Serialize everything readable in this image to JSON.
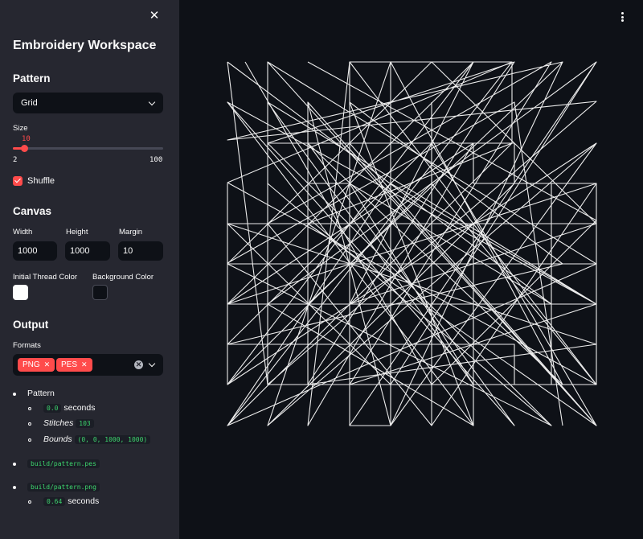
{
  "sidebar": {
    "title": "Embroidery Workspace",
    "pattern_section": {
      "heading": "Pattern",
      "select_value": "Grid",
      "size_label": "Size",
      "size_value": "10",
      "size_fraction": 0.0816,
      "size_min": "2",
      "size_max": "100",
      "shuffle_label": "Shuffle",
      "shuffle_checked": true
    },
    "canvas_section": {
      "heading": "Canvas",
      "width_label": "Width",
      "width_value": "1000",
      "height_label": "Height",
      "height_value": "1000",
      "margin_label": "Margin",
      "margin_value": "10",
      "thread_color_label": "Initial Thread Color",
      "thread_color": "#ffffff",
      "background_color_label": "Background Color",
      "background_color": "#0e1117"
    },
    "output_section": {
      "heading": "Output",
      "formats_label": "Formats",
      "formats": [
        "PNG",
        "PES"
      ]
    },
    "results": {
      "pattern_label": "Pattern",
      "pattern_time": "0.0",
      "seconds": "seconds",
      "stitches_label": "Stitches",
      "stitches_value": "103",
      "bounds_label": "Bounds",
      "bounds_value": "(0, 0, 1000, 1000)",
      "pes_path": "build/pattern.pes",
      "png_path": "build/pattern.png",
      "png_time": "0.64",
      "seconds_2": "seconds"
    }
  },
  "colors": {
    "accent": "#ff4b4b",
    "sidebar_bg": "#262730",
    "main_bg": "#0e1117",
    "code_text": "#3dd56d",
    "thread": "#ffffff"
  },
  "icons": {
    "close": "close-icon",
    "menu": "kebab-menu-icon",
    "dropdown": "chevron-down-icon",
    "clear": "clear-icon"
  }
}
